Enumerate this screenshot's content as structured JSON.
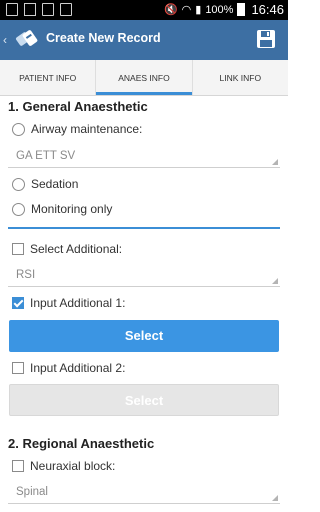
{
  "statusbar": {
    "battery": "100%",
    "time": "16:46"
  },
  "actionbar": {
    "back": "‹",
    "title": "Create New Record"
  },
  "tabs": [
    {
      "label": "PATIENT INFO",
      "active": false
    },
    {
      "label": "ANAES INFO",
      "active": true
    },
    {
      "label": "LINK INFO",
      "active": false
    }
  ],
  "general": {
    "heading": "1. General Anaesthetic",
    "airway_label": "Airway maintenance:",
    "airway_value": "GA ETT SV",
    "sedation_label": "Sedation",
    "monitoring_label": "Monitoring only",
    "select_additional_label": "Select Additional:",
    "select_additional_value": "RSI",
    "input_additional1_label": "Input Additional 1:",
    "input_additional1_checked": true,
    "select_button1": "Select",
    "input_additional2_label": "Input Additional 2:",
    "select_button2": "Select"
  },
  "regional": {
    "heading": "2. Regional Anaesthetic",
    "neuraxial_label": "Neuraxial block:",
    "neuraxial_value": "Spinal"
  },
  "colors": {
    "actionbar": "#3d6fa3",
    "accent": "#3b8ed6"
  }
}
